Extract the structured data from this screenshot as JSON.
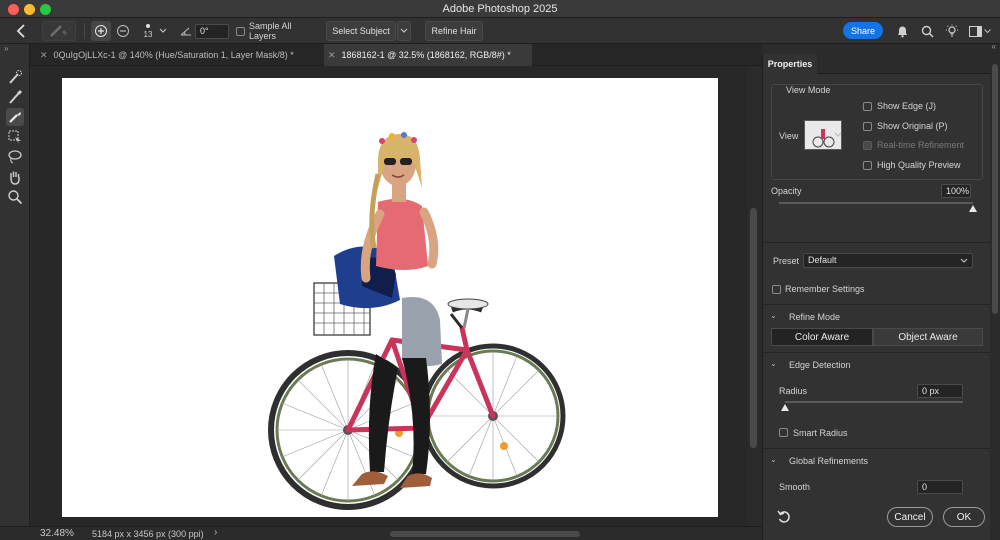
{
  "app": {
    "title": "Adobe Photoshop 2025"
  },
  "options": {
    "brush_size": "13",
    "angle_value": "0°",
    "sample_all_layers": "Sample All Layers",
    "select_subject": "Select Subject",
    "refine_hair": "Refine Hair",
    "share": "Share"
  },
  "tabs": [
    {
      "label": "0QuIgOjLLXc-1 @ 140% (Hue/Saturation 1, Layer Mask/8) *"
    },
    {
      "label": "1868162-1 @ 32.5% (1868162, RGB/8#) *"
    }
  ],
  "status": {
    "zoom": "32.48%",
    "doc_info": "5184 px x 3456 px (300 ppi)"
  },
  "properties": {
    "tab": "Properties",
    "view_mode": {
      "title": "View Mode",
      "view_label": "View",
      "show_edge": "Show Edge (J)",
      "show_original": "Show Original (P)",
      "realtime": "Real-time Refinement",
      "high_quality": "High Quality Preview"
    },
    "opacity": {
      "label": "Opacity",
      "value": "100%",
      "level": 1.0
    },
    "preset": {
      "label": "Preset",
      "value": "Default"
    },
    "remember": "Remember Settings",
    "refine_mode": {
      "title": "Refine Mode",
      "color_aware": "Color Aware",
      "object_aware": "Object Aware"
    },
    "edge_detection": {
      "title": "Edge Detection",
      "radius_label": "Radius",
      "radius_value": "0 px",
      "radius_level": 0.0,
      "smart_radius": "Smart Radius"
    },
    "global": {
      "title": "Global Refinements",
      "smooth_label": "Smooth",
      "smooth_value": "0"
    },
    "cancel": "Cancel",
    "ok": "OK"
  },
  "colors": {
    "accent": "#1473e6",
    "bike_frame": "#c8345a",
    "close": "#ff5f57",
    "minimize": "#febc2e",
    "maximize": "#28c840"
  }
}
